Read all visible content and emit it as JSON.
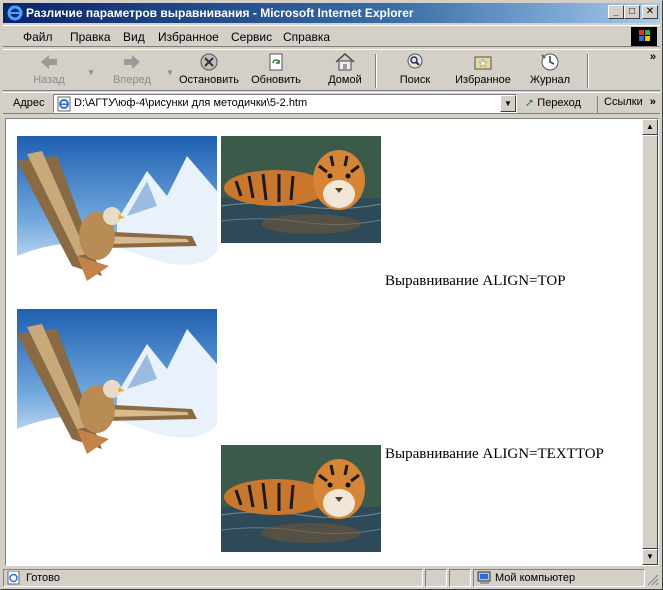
{
  "window": {
    "title": "Различие параметров выравнивания - Microsoft Internet Explorer",
    "minimize": "_",
    "maximize": "□",
    "close": "✕"
  },
  "menu": {
    "file": "Файл",
    "edit": "Правка",
    "view": "Вид",
    "favorites": "Избранное",
    "tools": "Сервис",
    "help": "Справка"
  },
  "toolbar": {
    "back": "Назад",
    "forward": "Вперед",
    "stop": "Остановить",
    "refresh": "Обновить",
    "home": "Домой",
    "search": "Поиск",
    "favorites": "Избранное",
    "history": "Журнал",
    "more": "»"
  },
  "address": {
    "label": "Адрес",
    "url": "D:\\АГТУ\\юф-4\\рисунки для методички\\5-2.htm",
    "go": "Переход",
    "links": "Ссылки"
  },
  "content": {
    "caption_top": "Выравнивание ALIGN=TOP",
    "caption_texttop": "Выравнивание ALIGN=TEXTTOP"
  },
  "status": {
    "text": "Готово",
    "zone": "Мой компьютер"
  },
  "icons": {
    "ie": "ie-logo-icon",
    "back": "back-arrow-icon",
    "forward": "forward-arrow-icon",
    "stop": "stop-icon",
    "refresh": "refresh-icon",
    "home": "home-icon",
    "search": "search-icon",
    "favorites": "favorites-icon",
    "history": "history-icon"
  }
}
